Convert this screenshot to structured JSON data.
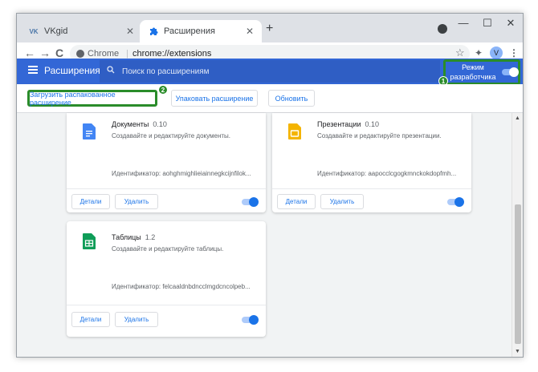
{
  "tabs": [
    {
      "title": "VKgid",
      "favicon": "VK",
      "close": "✕"
    },
    {
      "title": "Расширения",
      "favicon": "puzzle-piece",
      "close": "✕"
    }
  ],
  "new_tab": "+",
  "window_controls": {
    "minimize": "—",
    "maximize": "☐",
    "close": "✕"
  },
  "toolbar": {
    "back": "←",
    "forward": "→",
    "reload": "C",
    "omnibox_chip": "Chrome",
    "url": "chrome://extensions",
    "bookmark": "☆",
    "extensions": "✦",
    "profile_initial": "V",
    "menu": "⋮"
  },
  "header": {
    "title": "Расширения",
    "search_placeholder": "Поиск по расширениям",
    "dev_mode_label": "Режим разработчика",
    "dev_mode_on": true
  },
  "dev_buttons": {
    "load_unpacked": "Загрузить распакованное расширение",
    "pack": "Упаковать расширение",
    "update": "Обновить"
  },
  "badges": {
    "one": "1",
    "two": "2"
  },
  "cards": [
    {
      "name": "Документы",
      "version": "0.10",
      "description": "Создавайте и редактируйте документы.",
      "id_label": "Идентификатор: aohghmighlieiainnegkcijnfilok...",
      "details": "Детали",
      "remove": "Удалить",
      "icon_color": "#4285f4",
      "enabled": true
    },
    {
      "name": "Презентации",
      "version": "0.10",
      "description": "Создавайте и редактируйте презентации.",
      "id_label": "Идентификатор: aapocclcgogkmnckokdopfmh...",
      "details": "Детали",
      "remove": "Удалить",
      "icon_color": "#f4b400",
      "enabled": true
    },
    {
      "name": "Таблицы",
      "version": "1.2",
      "description": "Создавайте и редактируйте таблицы.",
      "id_label": "Идентификатор: felcaaldnbdncclmgdcncolpeb...",
      "details": "Детали",
      "remove": "Удалить",
      "icon_color": "#0f9d58",
      "enabled": true
    }
  ],
  "colors": {
    "header": "#3367d6",
    "accent": "#1a73e8",
    "highlight": "#2a8c2a"
  }
}
